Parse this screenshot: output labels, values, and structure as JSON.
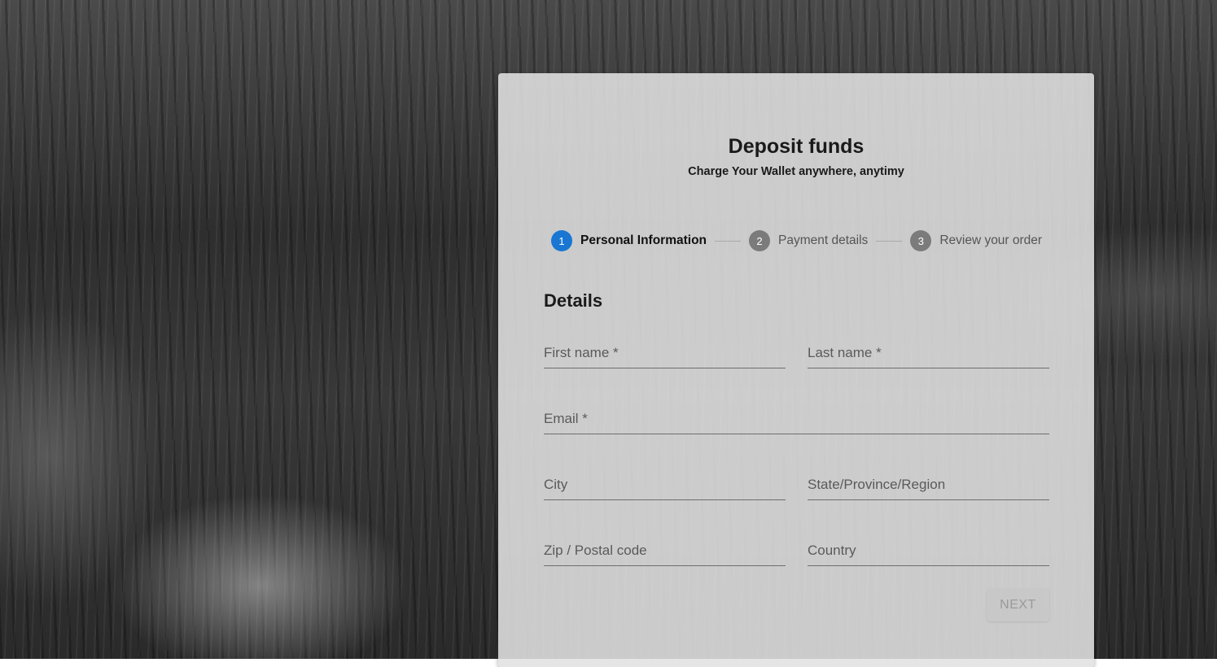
{
  "header": {
    "title": "Deposit funds",
    "subtitle": "Charge Your Wallet anywhere, anytimy"
  },
  "stepper": {
    "steps": [
      {
        "number": "1",
        "label": "Personal Information",
        "active": true
      },
      {
        "number": "2",
        "label": "Payment details",
        "active": false
      },
      {
        "number": "3",
        "label": "Review your order",
        "active": false
      }
    ]
  },
  "form": {
    "section_title": "Details",
    "fields": {
      "first_name": {
        "label": "First name *",
        "value": ""
      },
      "last_name": {
        "label": "Last name *",
        "value": ""
      },
      "email": {
        "label": "Email *",
        "value": ""
      },
      "city": {
        "label": "City",
        "value": ""
      },
      "state": {
        "label": "State/Province/Region",
        "value": ""
      },
      "zip": {
        "label": "Zip / Postal code",
        "value": ""
      },
      "country": {
        "label": "Country",
        "value": ""
      }
    },
    "next_label": "NEXT"
  },
  "colors": {
    "active_step": "#1976d2",
    "inactive_step": "#7b7b7b"
  }
}
